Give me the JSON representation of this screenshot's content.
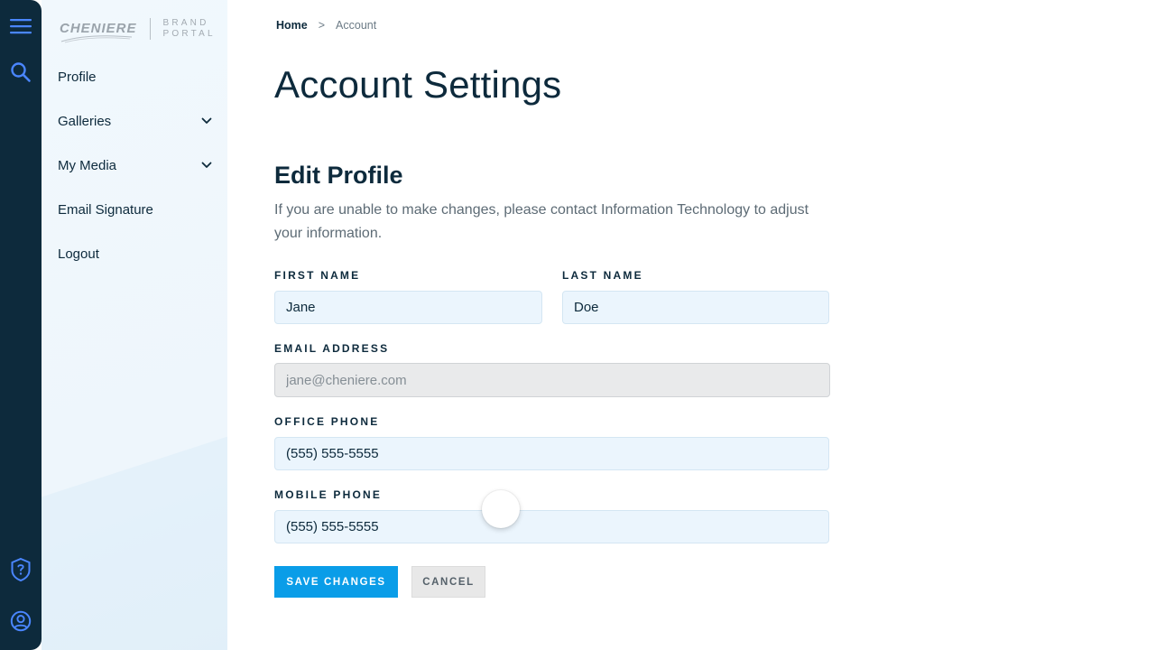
{
  "brand": {
    "name": "CHENIERE",
    "sub_line1": "BRAND",
    "sub_line2": "PORTAL"
  },
  "rail": {
    "icons": [
      "menu-icon",
      "search-icon",
      "help-shield-icon",
      "user-icon"
    ]
  },
  "sidebar": {
    "items": [
      {
        "label": "Profile",
        "has_children": false
      },
      {
        "label": "Galleries",
        "has_children": true
      },
      {
        "label": "My Media",
        "has_children": true
      },
      {
        "label": "Email Signature",
        "has_children": false
      },
      {
        "label": "Logout",
        "has_children": false
      }
    ]
  },
  "breadcrumb": {
    "home": "Home",
    "separator": ">",
    "current": "Account"
  },
  "page": {
    "title": "Account Settings",
    "section_title": "Edit Profile",
    "section_desc": "If you are unable to make changes, please contact Information Technology to adjust your information."
  },
  "form": {
    "first_name_label": "FIRST NAME",
    "first_name": "Jane",
    "last_name_label": "LAST NAME",
    "last_name": "Doe",
    "email_label": "EMAIL ADDRESS",
    "email": "jane@cheniere.com",
    "office_phone_label": "OFFICE PHONE",
    "office_phone": "(555) 555-5555",
    "mobile_phone_label": "MOBILE PHONE",
    "mobile_phone": "(555) 555-5555",
    "save_label": "SAVE CHANGES",
    "cancel_label": "CANCEL"
  },
  "colors": {
    "navy": "#0d2a3c",
    "accent_blue": "#0a9de8",
    "icon_blue": "#3f8cff",
    "field_bg": "#ebf5fd"
  }
}
